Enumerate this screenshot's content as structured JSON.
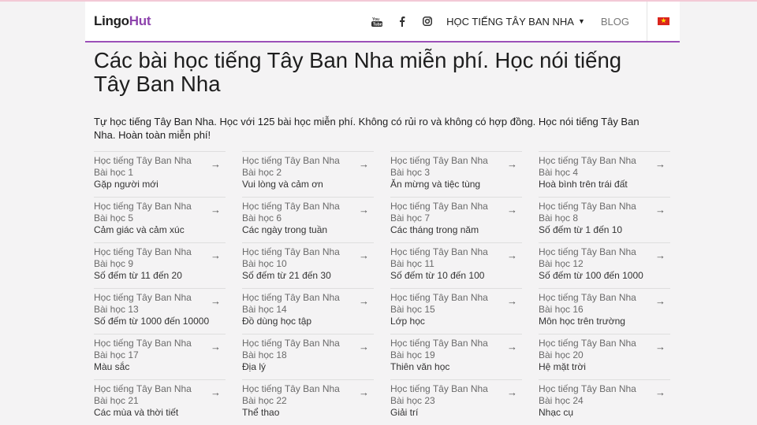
{
  "header": {
    "logo_part1": "Lingo",
    "logo_part2": "Hut",
    "language_menu": "HỌC TIẾNG TÂY BAN NHA",
    "blog": "BLOG",
    "icons": [
      "youtube-icon",
      "facebook-icon",
      "instagram-icon"
    ]
  },
  "main": {
    "title": "Các bài học tiếng Tây Ban Nha miễn phí. Học nói tiếng Tây Ban Nha",
    "intro": "Tự học tiếng Tây Ban Nha. Học với 125 bài học miễn phí. Không có rủi ro và không có hợp đồng. Học nói tiếng Tây Ban Nha. Hoàn toàn miễn phí!"
  },
  "lessons": [
    {
      "course": "Học tiếng Tây Ban Nha",
      "number": "Bài học 1",
      "topic": "Gặp người mới"
    },
    {
      "course": "Học tiếng Tây Ban Nha",
      "number": "Bài học 2",
      "topic": "Vui lòng và cảm ơn"
    },
    {
      "course": "Học tiếng Tây Ban Nha",
      "number": "Bài học 3",
      "topic": "Ăn mừng và tiệc tùng"
    },
    {
      "course": "Học tiếng Tây Ban Nha",
      "number": "Bài học 4",
      "topic": "Hoà bình trên trái đất"
    },
    {
      "course": "Học tiếng Tây Ban Nha",
      "number": "Bài học 5",
      "topic": "Cảm giác và cảm xúc"
    },
    {
      "course": "Học tiếng Tây Ban Nha",
      "number": "Bài học 6",
      "topic": "Các ngày trong tuần"
    },
    {
      "course": "Học tiếng Tây Ban Nha",
      "number": "Bài học 7",
      "topic": "Các tháng trong năm"
    },
    {
      "course": "Học tiếng Tây Ban Nha",
      "number": "Bài học 8",
      "topic": "Số đếm từ 1 đến 10"
    },
    {
      "course": "Học tiếng Tây Ban Nha",
      "number": "Bài học 9",
      "topic": "Số đếm từ 11 đến 20"
    },
    {
      "course": "Học tiếng Tây Ban Nha",
      "number": "Bài học 10",
      "topic": "Số đếm từ 21 đến 30"
    },
    {
      "course": "Học tiếng Tây Ban Nha",
      "number": "Bài học 11",
      "topic": "Số đếm từ 10 đến 100"
    },
    {
      "course": "Học tiếng Tây Ban Nha",
      "number": "Bài học 12",
      "topic": "Số đếm từ 100 đến 1000"
    },
    {
      "course": "Học tiếng Tây Ban Nha",
      "number": "Bài học 13",
      "topic": "Số đếm từ 1000 đến 10000"
    },
    {
      "course": "Học tiếng Tây Ban Nha",
      "number": "Bài học 14",
      "topic": "Đồ dùng học tập"
    },
    {
      "course": "Học tiếng Tây Ban Nha",
      "number": "Bài học 15",
      "topic": "Lớp học"
    },
    {
      "course": "Học tiếng Tây Ban Nha",
      "number": "Bài học 16",
      "topic": "Môn học trên trường"
    },
    {
      "course": "Học tiếng Tây Ban Nha",
      "number": "Bài học 17",
      "topic": "Màu sắc"
    },
    {
      "course": "Học tiếng Tây Ban Nha",
      "number": "Bài học 18",
      "topic": "Địa lý"
    },
    {
      "course": "Học tiếng Tây Ban Nha",
      "number": "Bài học 19",
      "topic": "Thiên văn học"
    },
    {
      "course": "Học tiếng Tây Ban Nha",
      "number": "Bài học 20",
      "topic": "Hệ mặt trời"
    },
    {
      "course": "Học tiếng Tây Ban Nha",
      "number": "Bài học 21",
      "topic": "Các mùa và thời tiết"
    },
    {
      "course": "Học tiếng Tây Ban Nha",
      "number": "Bài học 22",
      "topic": "Thể thao"
    },
    {
      "course": "Học tiếng Tây Ban Nha",
      "number": "Bài học 23",
      "topic": "Giải trí"
    },
    {
      "course": "Học tiếng Tây Ban Nha",
      "number": "Bài học 24",
      "topic": "Nhạc cụ"
    }
  ],
  "colors": {
    "accent": "#9b4fb8",
    "logo_hut": "#8e44ad",
    "background": "#f4f3f4",
    "flag_red": "#da251d",
    "flag_star": "#ffde00"
  }
}
